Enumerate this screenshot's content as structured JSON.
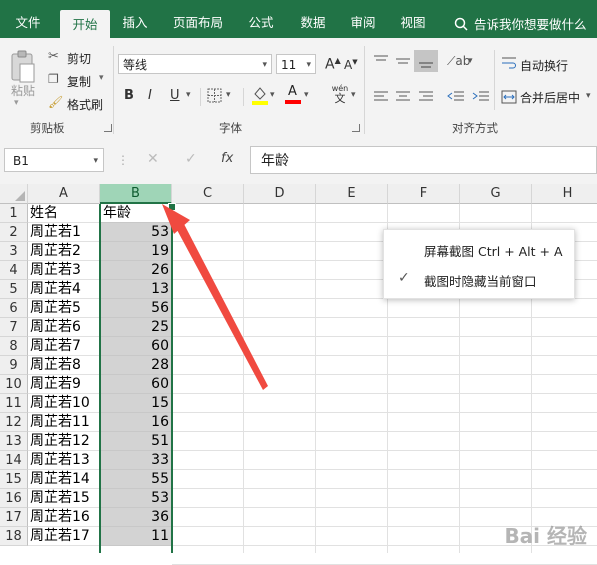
{
  "ribbon_tabs": [
    "文件",
    "开始",
    "插入",
    "页面布局",
    "公式",
    "数据",
    "审阅",
    "视图"
  ],
  "active_tab": "开始",
  "tell_me": "告诉我你想要做什么",
  "clipboard": {
    "paste": "粘贴",
    "cut": "剪切",
    "copy": "复制",
    "format_painter": "格式刷",
    "group": "剪贴板"
  },
  "font": {
    "name": "等线",
    "size": "11",
    "grow": "A",
    "shrink": "A",
    "bold": "B",
    "italic": "I",
    "underline": "U",
    "wen": "wén",
    "wen_sub": "文",
    "group": "字体"
  },
  "alignment": {
    "wrap_text": "自动换行",
    "merge_center": "合并后居中",
    "group": "对齐方式"
  },
  "formula_bar": {
    "name_box": "B1",
    "fx": "fx",
    "content": "年龄"
  },
  "columns": [
    "A",
    "B",
    "C",
    "D",
    "E",
    "F",
    "G",
    "H"
  ],
  "rows": [
    {
      "num": "1",
      "name": "姓名",
      "age": "年龄"
    },
    {
      "num": "2",
      "name": "周芷若1",
      "age": "53"
    },
    {
      "num": "3",
      "name": "周芷若2",
      "age": "19"
    },
    {
      "num": "4",
      "name": "周芷若3",
      "age": "26"
    },
    {
      "num": "5",
      "name": "周芷若4",
      "age": "13"
    },
    {
      "num": "6",
      "name": "周芷若5",
      "age": "56"
    },
    {
      "num": "7",
      "name": "周芷若6",
      "age": "25"
    },
    {
      "num": "8",
      "name": "周芷若7",
      "age": "60"
    },
    {
      "num": "9",
      "name": "周芷若8",
      "age": "28"
    },
    {
      "num": "10",
      "name": "周芷若9",
      "age": "60"
    },
    {
      "num": "11",
      "name": "周芷若10",
      "age": "15"
    },
    {
      "num": "12",
      "name": "周芷若11",
      "age": "16"
    },
    {
      "num": "13",
      "name": "周芷若12",
      "age": "51"
    },
    {
      "num": "14",
      "name": "周芷若13",
      "age": "33"
    },
    {
      "num": "15",
      "name": "周芷若14",
      "age": "55"
    },
    {
      "num": "16",
      "name": "周芷若15",
      "age": "53"
    },
    {
      "num": "17",
      "name": "周芷若16",
      "age": "36"
    },
    {
      "num": "18",
      "name": "周芷若17",
      "age": "11"
    }
  ],
  "popup": {
    "item1": "屏幕截图 Ctrl + Alt + A",
    "item2": "截图时隐藏当前窗口"
  },
  "watermark": "Bai 经验",
  "colors": {
    "excel_green": "#217346",
    "selected_fill": "#d3d3d3",
    "arrow": "#f04a40"
  }
}
